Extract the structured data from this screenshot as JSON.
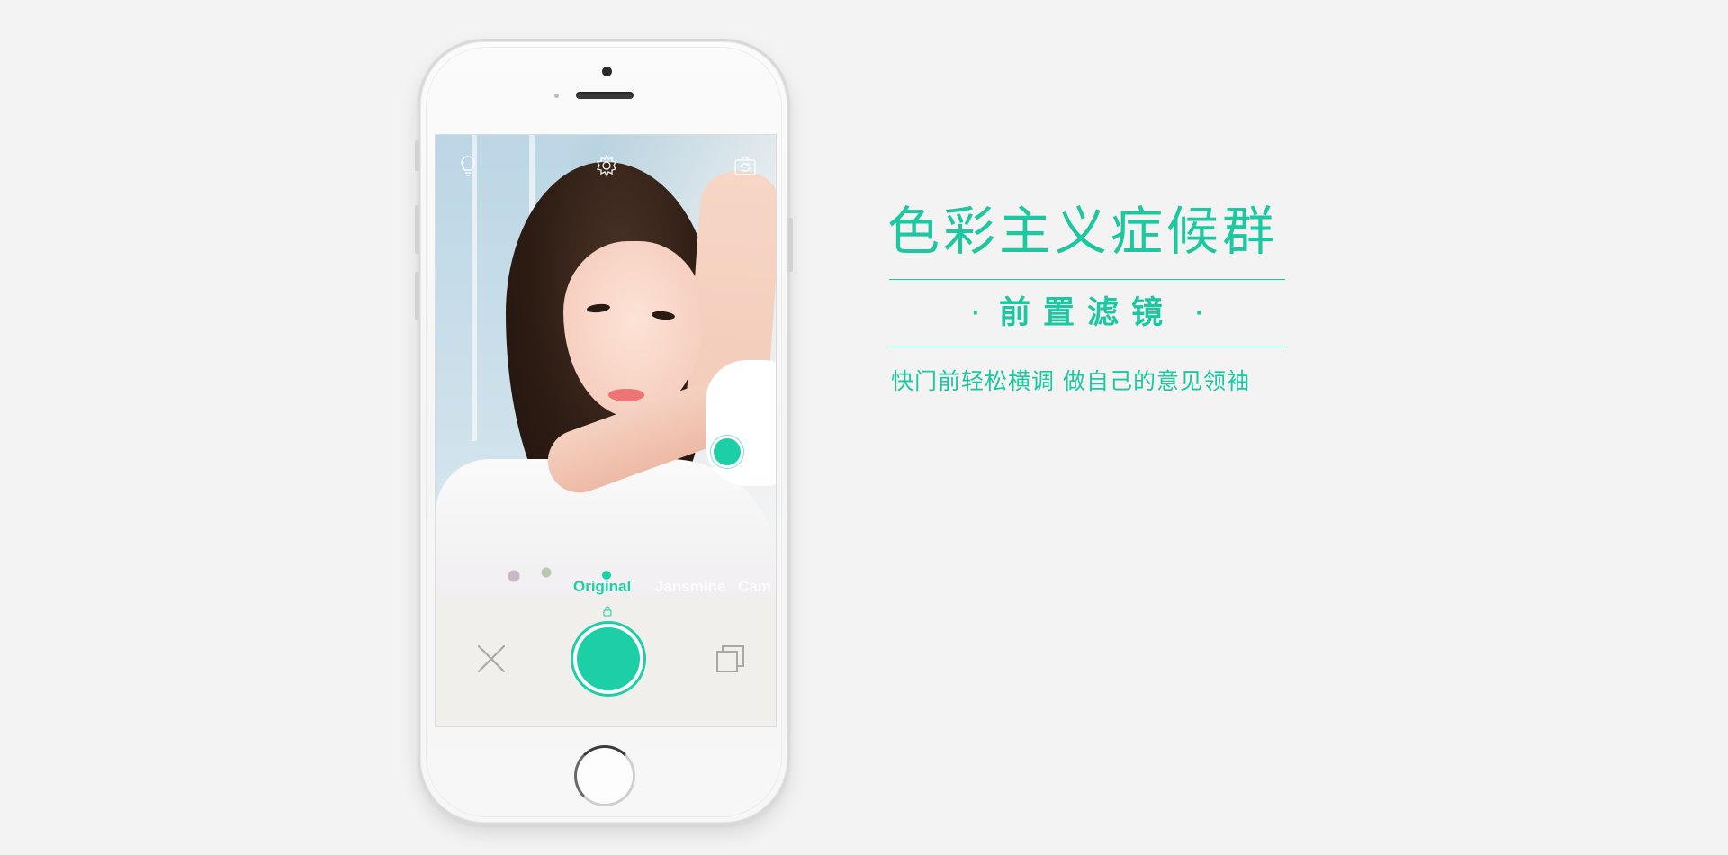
{
  "colors": {
    "accent": "#1dcfa6",
    "text_accent": "#1dc79f",
    "background": "#f3f3f3",
    "phone_body": "#f7f7f7"
  },
  "camera_app": {
    "top_bar": {
      "icons": [
        "flash-icon",
        "settings-icon",
        "camera-switch-icon"
      ]
    },
    "filters": {
      "items": [
        "Original",
        "Jansmine",
        "Cam"
      ],
      "selected": "Original"
    },
    "controls": {
      "icons": [
        "lock-icon",
        "close-icon",
        "shutter-button",
        "gallery-icon"
      ]
    }
  },
  "promo": {
    "title": "色彩主义症候群",
    "subtitle": "前置滤镜",
    "subtitle_dot": "·",
    "tagline": "快门前轻松横调 做自己的意见领袖"
  }
}
